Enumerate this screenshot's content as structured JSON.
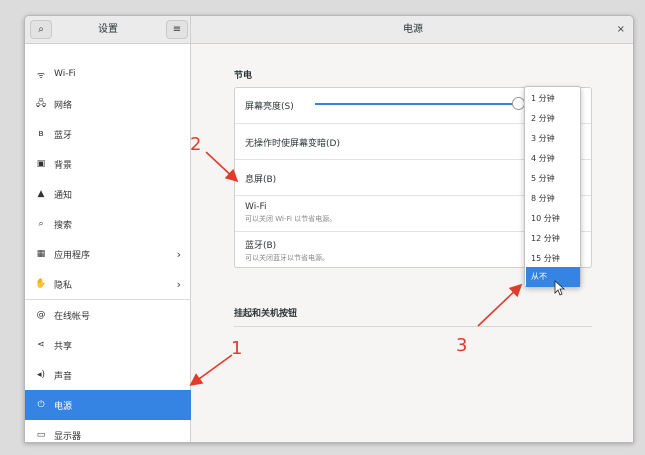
{
  "header": {
    "left_title": "设置",
    "right_title": "电源",
    "menu_glyph": "≡",
    "close_glyph": "×",
    "search_glyph": "⌕"
  },
  "sidebar": {
    "items": [
      {
        "icon": "wifi-icon",
        "glyph": "ᯤ",
        "label": "Wi-Fi",
        "chevron": ""
      },
      {
        "icon": "network-icon",
        "glyph": "🖧",
        "label": "网络",
        "chevron": ""
      },
      {
        "icon": "bluetooth-icon",
        "glyph": "ʙ",
        "label": "蓝牙",
        "chevron": ""
      },
      {
        "icon": "background-icon",
        "glyph": "▣",
        "label": "背景",
        "chevron": ""
      },
      {
        "icon": "bell-icon",
        "glyph": "▲",
        "label": "通知",
        "chevron": ""
      },
      {
        "icon": "search-icon",
        "glyph": "⌕",
        "label": "搜索",
        "chevron": ""
      },
      {
        "icon": "apps-grid-icon",
        "glyph": "▦",
        "label": "应用程序",
        "chevron": "›"
      },
      {
        "icon": "privacy-hand-icon",
        "glyph": "✋",
        "label": "隐私",
        "chevron": "›"
      },
      {
        "icon": "online-accounts-icon",
        "glyph": "@",
        "label": "在线帐号",
        "chevron": ""
      },
      {
        "icon": "share-icon",
        "glyph": "⋖",
        "label": "共享",
        "chevron": ""
      },
      {
        "icon": "sound-icon",
        "glyph": "◂)",
        "label": "声音",
        "chevron": ""
      },
      {
        "icon": "power-icon",
        "glyph": "⏻",
        "label": "电源",
        "chevron": ""
      },
      {
        "icon": "display-icon",
        "glyph": "▭",
        "label": "显示器",
        "chevron": ""
      }
    ],
    "active_index": 11
  },
  "main": {
    "section_power_saving": "节电",
    "rows": [
      {
        "label": "屏幕亮度(S)",
        "sub": ""
      },
      {
        "label": "无操作时使屏幕变暗(D)",
        "sub": ""
      },
      {
        "label": "息屏(B)",
        "sub": ""
      },
      {
        "label": "Wi-Fi",
        "sub": "可以关闭 Wi-Fi 以节省电源。"
      },
      {
        "label": "蓝牙(B)",
        "sub": "可以关闭蓝牙以节省电源。"
      }
    ],
    "brightness_level": 0.97,
    "section_suspend": "挂起和关机按钮"
  },
  "blank_popup": {
    "options": [
      "1 分钟",
      "2 分钟",
      "3 分钟",
      "4 分钟",
      "5 分钟",
      "8 分钟",
      "10 分钟",
      "12 分钟",
      "15 分钟",
      "从不"
    ],
    "selected_index": 9
  },
  "annotations": {
    "numbers": [
      "1",
      "2",
      "3"
    ],
    "color": "#e03c2b"
  },
  "colors": {
    "accent": "#3584e4"
  }
}
